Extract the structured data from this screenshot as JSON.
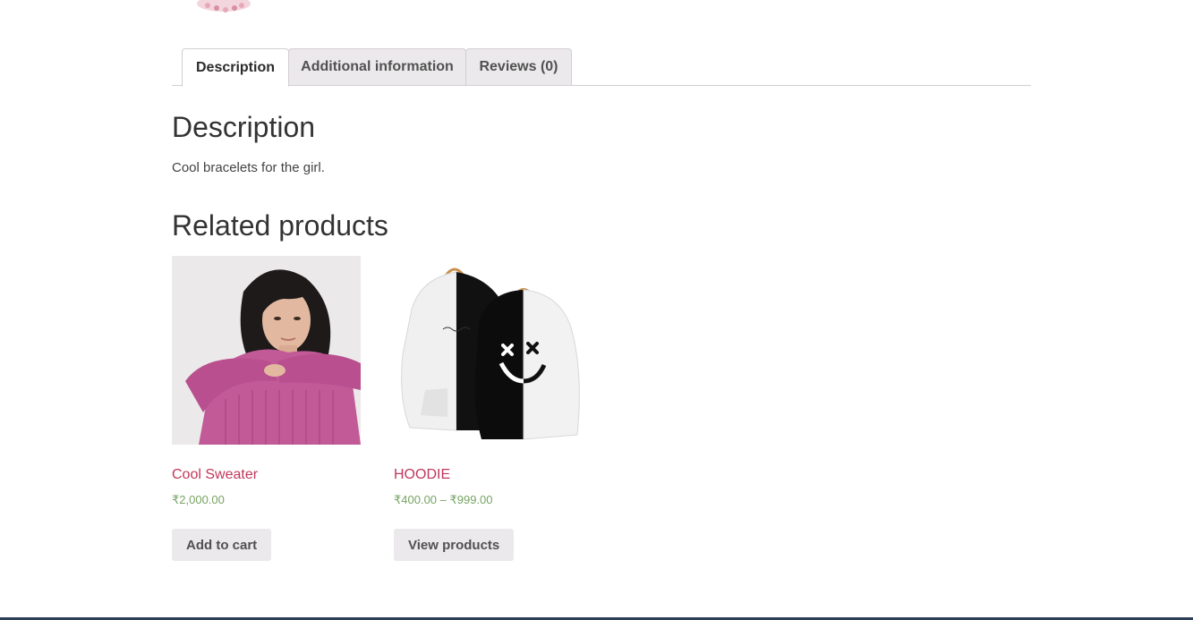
{
  "tabs": [
    {
      "label": "Description",
      "active": true
    },
    {
      "label": "Additional information",
      "active": false
    },
    {
      "label": "Reviews (0)",
      "active": false
    }
  ],
  "description": {
    "heading": "Description",
    "text": "Cool bracelets for the girl."
  },
  "related": {
    "heading": "Related products",
    "products": [
      {
        "title": "Cool Sweater",
        "price": "₹2,000.00",
        "button": "Add to cart",
        "image": "woman-pink-sweater-photo"
      },
      {
        "title": "HOODIE",
        "price": "₹400.00 – ₹999.00",
        "button": "View products",
        "image": "black-white-hoodie-photo"
      }
    ]
  },
  "colors": {
    "link": "#c0385b",
    "price": "#77a464",
    "tab_bg": "#ebe9eb",
    "button_bg": "#ebe9eb",
    "bottom_bar": "#2c3e55"
  }
}
